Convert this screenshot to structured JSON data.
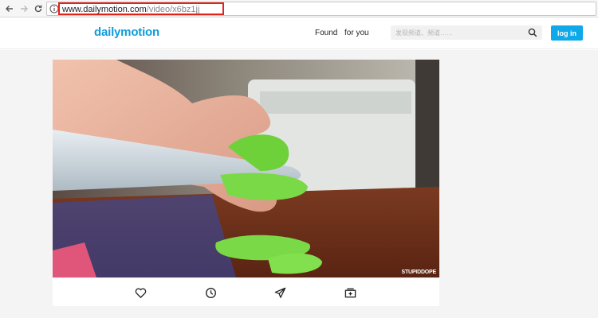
{
  "browser": {
    "url_host": "www.dailymotion.com",
    "url_path": "/video/x6bz1jj"
  },
  "header": {
    "logo": "dailymotion",
    "nav": [
      {
        "label": "Found"
      },
      {
        "label": "for you"
      }
    ],
    "search": {
      "placeholder": "发现频道、频道……"
    },
    "login_label": "log in"
  },
  "video": {
    "watermark": "STUPIDDOPE"
  },
  "actions": [
    {
      "icon": "heart-icon"
    },
    {
      "icon": "clock-icon"
    },
    {
      "icon": "share-icon"
    },
    {
      "icon": "add-to-playlist-icon"
    }
  ],
  "colors": {
    "brand": "#0d9ddb",
    "login_button": "#0fa8e8",
    "url_highlight": "#e2231a"
  }
}
